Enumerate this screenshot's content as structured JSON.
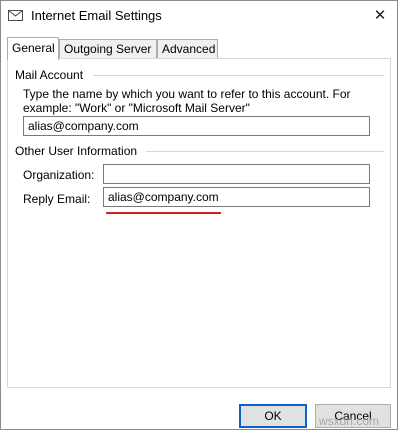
{
  "window": {
    "title": "Internet Email Settings"
  },
  "icons": {
    "app": "envelope-settings-icon",
    "close": "close-icon"
  },
  "tabs": [
    {
      "label": "General",
      "selected": true
    },
    {
      "label": "Outgoing Server",
      "selected": false
    },
    {
      "label": "Advanced",
      "selected": false
    }
  ],
  "mail_account": {
    "group_title": "Mail Account",
    "description": "Type the name by which you want to refer to this account. For example: \"Work\" or \"Microsoft Mail Server\"",
    "account_name_value": "alias@company.com"
  },
  "other_user_info": {
    "group_title": "Other User Information",
    "organization_label": "Organization:",
    "organization_value": "",
    "reply_email_label": "Reply Email:",
    "reply_email_value": "alias@company.com"
  },
  "buttons": {
    "ok": "OK",
    "cancel": "Cancel"
  },
  "watermark": "wsxdn.com",
  "colors": {
    "underline": "#d21f1f",
    "default_button_border": "#0a64c8"
  }
}
